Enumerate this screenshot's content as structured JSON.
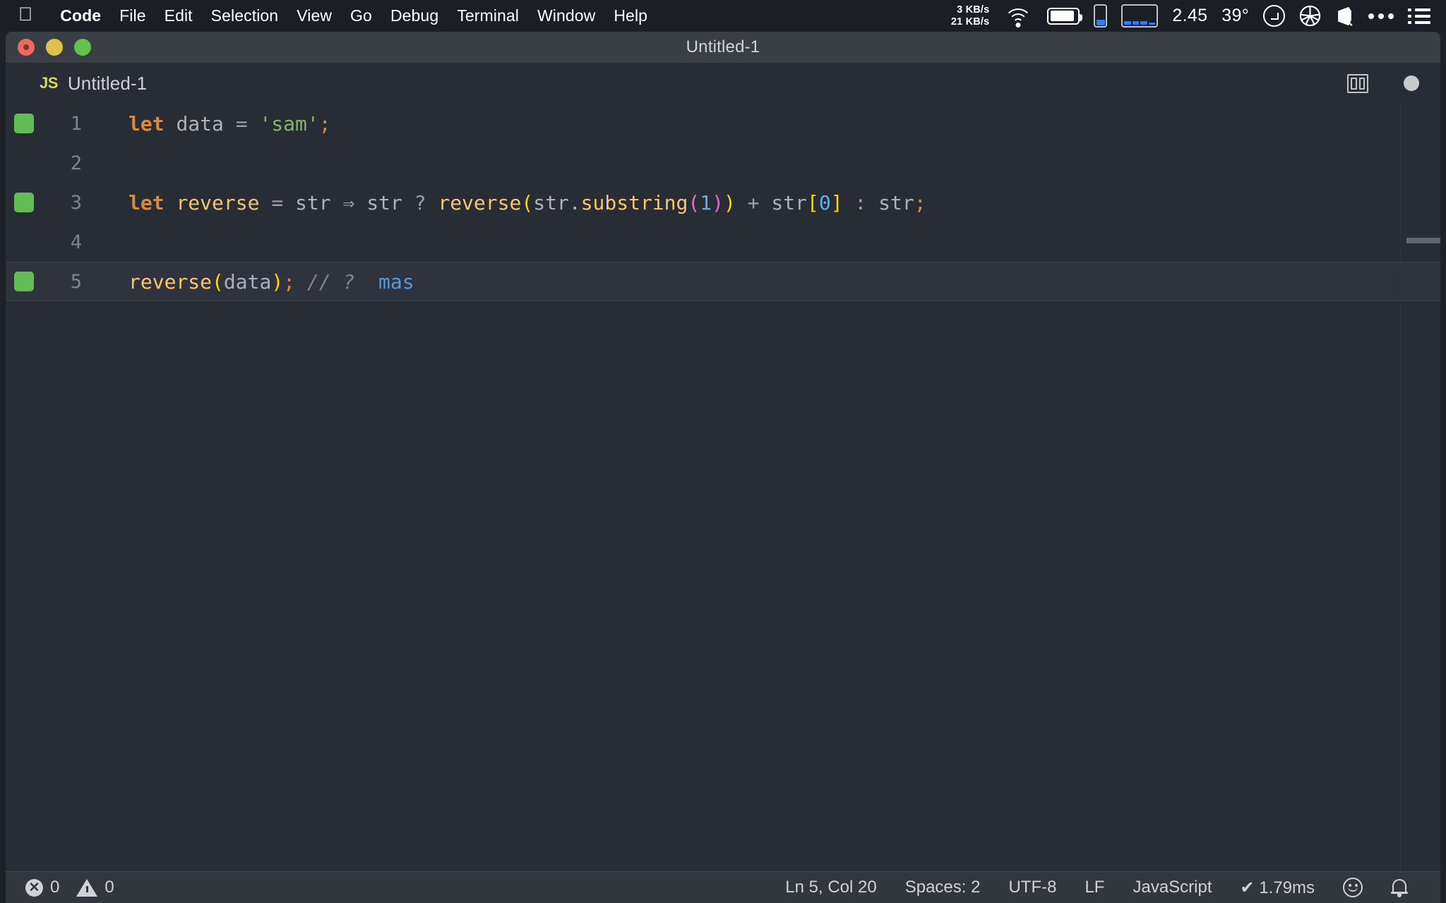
{
  "menubar": {
    "apple_glyph": "&#63743;",
    "items": [
      {
        "label": "Code",
        "bold": true
      },
      {
        "label": "File",
        "bold": false
      },
      {
        "label": "Edit",
        "bold": false
      },
      {
        "label": "Selection",
        "bold": false
      },
      {
        "label": "View",
        "bold": false
      },
      {
        "label": "Go",
        "bold": false
      },
      {
        "label": "Debug",
        "bold": false
      },
      {
        "label": "Terminal",
        "bold": false
      },
      {
        "label": "Window",
        "bold": false
      },
      {
        "label": "Help",
        "bold": false
      }
    ],
    "network_down": "3 KB/s",
    "network_up": "21 KB/s",
    "cpu_value": "2.45",
    "temperature": "39°",
    "icons": [
      "wifi-icon",
      "battery-icon",
      "phone-gauge-icon",
      "histogram-icon",
      "clock-circle-icon",
      "aperture-icon",
      "dropbox-icon",
      "ellipsis-icon",
      "list-icon"
    ]
  },
  "window": {
    "title": "Untitled-1",
    "traffic_lights": [
      "close",
      "minimize",
      "zoom"
    ]
  },
  "tab": {
    "file_icon_label": "JS",
    "name": "Untitled-1",
    "dirty": true,
    "split_editor_label": "Split Editor"
  },
  "editor": {
    "lines": [
      {
        "number": "1",
        "marker": true,
        "active": false
      },
      {
        "number": "2",
        "marker": false,
        "active": false
      },
      {
        "number": "3",
        "marker": true,
        "active": false
      },
      {
        "number": "4",
        "marker": false,
        "active": false
      },
      {
        "number": "5",
        "marker": true,
        "active": true
      }
    ],
    "code": {
      "l1_kw": "let",
      "l1_var": "data",
      "l1_eq": "=",
      "l1_str": "'sam'",
      "l1_semi": ";",
      "l3_kw": "let",
      "l3_fn": "reverse",
      "l3_eq": "=",
      "l3_p1": "str",
      "l3_arrow": "⇒",
      "l3_p2": "str",
      "l3_q": "?",
      "l3_call": "reverse",
      "l3_lp1": "(",
      "l3_obj": "str.",
      "l3_method": "substring",
      "l3_lp2": "(",
      "l3_num1": "1",
      "l3_rp2": ")",
      "l3_rp1": ")",
      "l3_plus": "+",
      "l3_str2": "str",
      "l3_lb": "[",
      "l3_num0": "0",
      "l3_rb": "]",
      "l3_colon": ":",
      "l3_str3": "str",
      "l3_semi": ";",
      "l5_call": "reverse",
      "l5_lp": "(",
      "l5_arg": "data",
      "l5_rp": ")",
      "l5_semi": ";",
      "l5_comment": "// ?",
      "l5_value": "mas"
    }
  },
  "statusbar": {
    "errors": "0",
    "warnings": "0",
    "cursor": "Ln 5, Col 20",
    "indentation": "Spaces: 2",
    "encoding": "UTF-8",
    "eol": "LF",
    "language": "JavaScript",
    "runtime": "✔ 1.79ms",
    "feedback_icon": "smiley-icon",
    "notifications_icon": "bell-icon"
  },
  "colors": {
    "accent_green": "#63bd55",
    "keyword": "#d98a42",
    "string": "#86b668",
    "function": "#f0c674",
    "number": "#62aeef",
    "bracket_yellow": "#ffd800",
    "bracket_magenta": "#e06ccf",
    "quokka_value": "#529bdd",
    "editor_bg": "#282c34",
    "titlebar_bg": "#3a3f46",
    "statusbar_bg": "#32363d"
  }
}
